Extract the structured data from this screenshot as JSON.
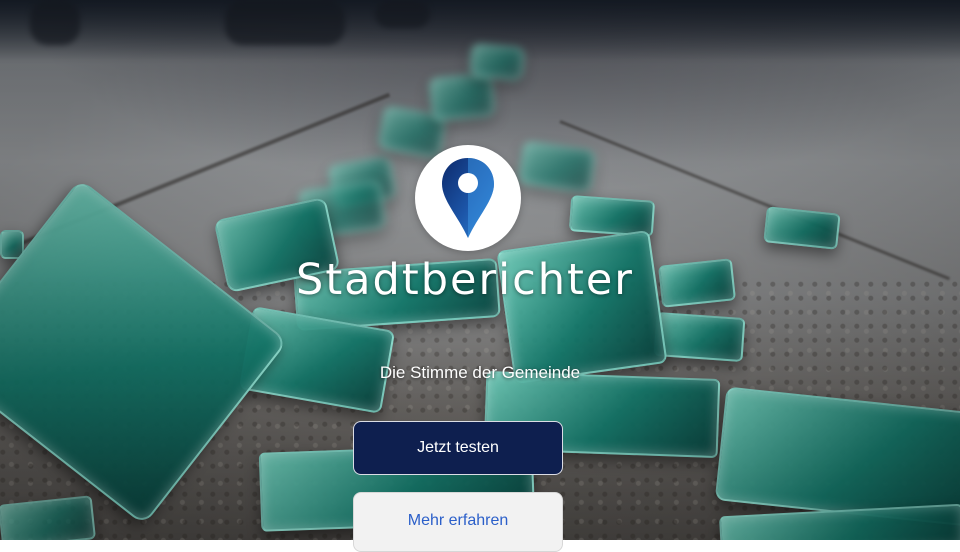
{
  "brand": {
    "name": "Stadtberichter",
    "tagline": "Die Stimme der Gemeinde",
    "logo_icon": "map-pin-icon",
    "logo_colors": {
      "pin_dark": "#0d2a6b",
      "pin_light": "#2f86d6",
      "circle": "#ffffff"
    }
  },
  "actions": {
    "primary_label": "Jetzt testen",
    "secondary_label": "Mehr erfahren"
  },
  "colors": {
    "primary_button_bg": "#0e1f4f",
    "secondary_button_bg": "#f2f2f2",
    "secondary_button_text": "#2b5fc9",
    "glass_accent": "#2fae9b"
  }
}
